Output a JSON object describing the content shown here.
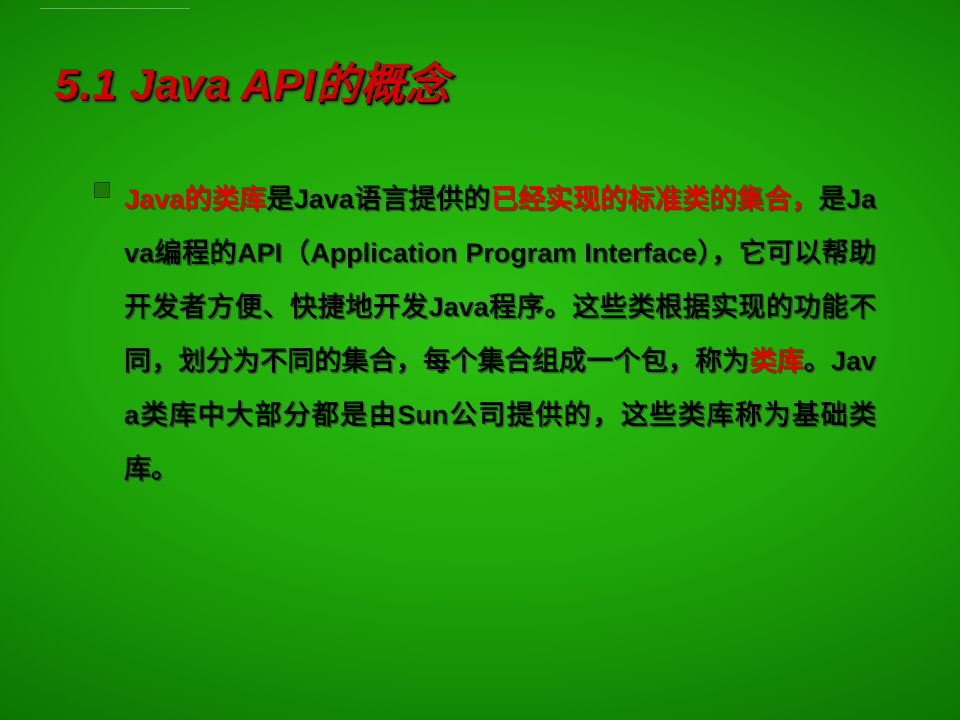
{
  "slide": {
    "title": "5.1 Java API的概念",
    "bullet": {
      "seg1_red": "Java的类库",
      "seg2": "是Java语言提供的",
      "seg3_red": "已经实现的标准类的集合，",
      "seg4": "是Java编程的API（Application Program Interface），它可以帮助开发者方便、快捷地开发Java程序。这些类根据实现的功能不同，划分为不同的集合，每个集合组成一个包，称为",
      "seg5_red": "类库",
      "seg6": "。Java类库中大部分都是由Sun公司提供的，这些类库称为基础类库。"
    }
  }
}
